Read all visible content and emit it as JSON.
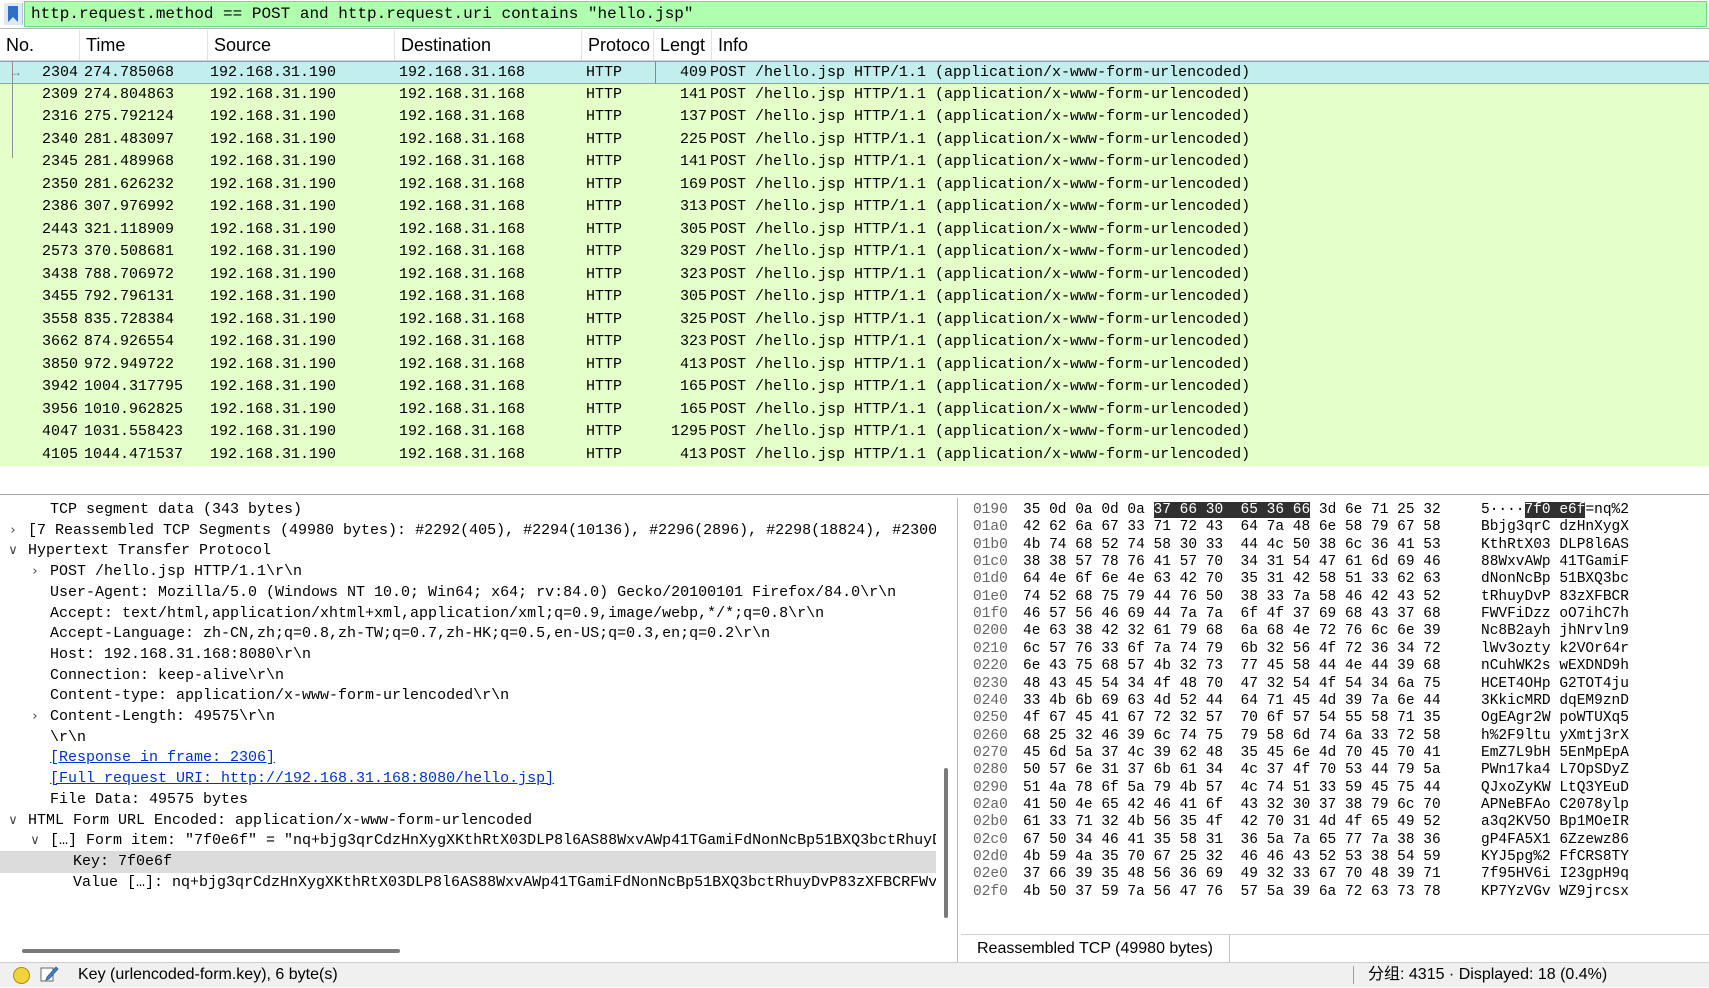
{
  "filter": {
    "text": "http.request.method == POST and http.request.uri contains \"hello.jsp\""
  },
  "columns": [
    "No.",
    "Time",
    "Source",
    "Destination",
    "Protoco",
    "Lengt",
    "Info"
  ],
  "packets": [
    {
      "no": "2304",
      "time": "274.785068",
      "src": "192.168.31.190",
      "dst": "192.168.31.168",
      "proto": "HTTP",
      "len": "409",
      "info": "POST /hello.jsp HTTP/1.1  (application/x-www-form-urlencoded)",
      "selected": true
    },
    {
      "no": "2309",
      "time": "274.804863",
      "src": "192.168.31.190",
      "dst": "192.168.31.168",
      "proto": "HTTP",
      "len": "141",
      "info": "POST /hello.jsp HTTP/1.1  (application/x-www-form-urlencoded)"
    },
    {
      "no": "2316",
      "time": "275.792124",
      "src": "192.168.31.190",
      "dst": "192.168.31.168",
      "proto": "HTTP",
      "len": "137",
      "info": "POST /hello.jsp HTTP/1.1  (application/x-www-form-urlencoded)"
    },
    {
      "no": "2340",
      "time": "281.483097",
      "src": "192.168.31.190",
      "dst": "192.168.31.168",
      "proto": "HTTP",
      "len": "225",
      "info": "POST /hello.jsp HTTP/1.1  (application/x-www-form-urlencoded)"
    },
    {
      "no": "2345",
      "time": "281.489968",
      "src": "192.168.31.190",
      "dst": "192.168.31.168",
      "proto": "HTTP",
      "len": "141",
      "info": "POST /hello.jsp HTTP/1.1  (application/x-www-form-urlencoded)"
    },
    {
      "no": "2350",
      "time": "281.626232",
      "src": "192.168.31.190",
      "dst": "192.168.31.168",
      "proto": "HTTP",
      "len": "169",
      "info": "POST /hello.jsp HTTP/1.1  (application/x-www-form-urlencoded)"
    },
    {
      "no": "2386",
      "time": "307.976992",
      "src": "192.168.31.190",
      "dst": "192.168.31.168",
      "proto": "HTTP",
      "len": "313",
      "info": "POST /hello.jsp HTTP/1.1  (application/x-www-form-urlencoded)"
    },
    {
      "no": "2443",
      "time": "321.118909",
      "src": "192.168.31.190",
      "dst": "192.168.31.168",
      "proto": "HTTP",
      "len": "305",
      "info": "POST /hello.jsp HTTP/1.1  (application/x-www-form-urlencoded)"
    },
    {
      "no": "2573",
      "time": "370.508681",
      "src": "192.168.31.190",
      "dst": "192.168.31.168",
      "proto": "HTTP",
      "len": "329",
      "info": "POST /hello.jsp HTTP/1.1  (application/x-www-form-urlencoded)"
    },
    {
      "no": "3438",
      "time": "788.706972",
      "src": "192.168.31.190",
      "dst": "192.168.31.168",
      "proto": "HTTP",
      "len": "323",
      "info": "POST /hello.jsp HTTP/1.1  (application/x-www-form-urlencoded)"
    },
    {
      "no": "3455",
      "time": "792.796131",
      "src": "192.168.31.190",
      "dst": "192.168.31.168",
      "proto": "HTTP",
      "len": "305",
      "info": "POST /hello.jsp HTTP/1.1  (application/x-www-form-urlencoded)"
    },
    {
      "no": "3558",
      "time": "835.728384",
      "src": "192.168.31.190",
      "dst": "192.168.31.168",
      "proto": "HTTP",
      "len": "325",
      "info": "POST /hello.jsp HTTP/1.1  (application/x-www-form-urlencoded)"
    },
    {
      "no": "3662",
      "time": "874.926554",
      "src": "192.168.31.190",
      "dst": "192.168.31.168",
      "proto": "HTTP",
      "len": "323",
      "info": "POST /hello.jsp HTTP/1.1  (application/x-www-form-urlencoded)"
    },
    {
      "no": "3850",
      "time": "972.949722",
      "src": "192.168.31.190",
      "dst": "192.168.31.168",
      "proto": "HTTP",
      "len": "413",
      "info": "POST /hello.jsp HTTP/1.1  (application/x-www-form-urlencoded)"
    },
    {
      "no": "3942",
      "time": "1004.317795",
      "src": "192.168.31.190",
      "dst": "192.168.31.168",
      "proto": "HTTP",
      "len": "165",
      "info": "POST /hello.jsp HTTP/1.1  (application/x-www-form-urlencoded)"
    },
    {
      "no": "3956",
      "time": "1010.962825",
      "src": "192.168.31.190",
      "dst": "192.168.31.168",
      "proto": "HTTP",
      "len": "165",
      "info": "POST /hello.jsp HTTP/1.1  (application/x-www-form-urlencoded)"
    },
    {
      "no": "4047",
      "time": "1031.558423",
      "src": "192.168.31.190",
      "dst": "192.168.31.168",
      "proto": "HTTP",
      "len": "1295",
      "info": "POST /hello.jsp HTTP/1.1  (application/x-www-form-urlencoded)"
    },
    {
      "no": "4105",
      "time": "1044.471537",
      "src": "192.168.31.190",
      "dst": "192.168.31.168",
      "proto": "HTTP",
      "len": "413",
      "info": "POST /hello.jsp HTTP/1.1  (application/x-www-form-urlencoded)"
    }
  ],
  "details": [
    {
      "text": "TCP segment data (343 bytes)",
      "indent": 2,
      "arrow": ""
    },
    {
      "text": "[7 Reassembled TCP Segments (49980 bytes): #2292(405), #2294(10136), #2296(2896), #2298(18824), #2300",
      "indent": 1,
      "arrow": "collapsed"
    },
    {
      "text": "Hypertext Transfer Protocol",
      "indent": 1,
      "arrow": "expanded"
    },
    {
      "text": "POST /hello.jsp HTTP/1.1\\r\\n",
      "indent": 2,
      "arrow": "collapsed"
    },
    {
      "text": "User-Agent: Mozilla/5.0 (Windows NT 10.0; Win64; x64; rv:84.0) Gecko/20100101 Firefox/84.0\\r\\n",
      "indent": 2,
      "arrow": ""
    },
    {
      "text": "Accept: text/html,application/xhtml+xml,application/xml;q=0.9,image/webp,*/*;q=0.8\\r\\n",
      "indent": 2,
      "arrow": ""
    },
    {
      "text": "Accept-Language: zh-CN,zh;q=0.8,zh-TW;q=0.7,zh-HK;q=0.5,en-US;q=0.3,en;q=0.2\\r\\n",
      "indent": 2,
      "arrow": ""
    },
    {
      "text": "Host: 192.168.31.168:8080\\r\\n",
      "indent": 2,
      "arrow": ""
    },
    {
      "text": "Connection: keep-alive\\r\\n",
      "indent": 2,
      "arrow": ""
    },
    {
      "text": "Content-type: application/x-www-form-urlencoded\\r\\n",
      "indent": 2,
      "arrow": ""
    },
    {
      "text": "Content-Length: 49575\\r\\n",
      "indent": 2,
      "arrow": "collapsed"
    },
    {
      "text": "\\r\\n",
      "indent": 2,
      "arrow": ""
    },
    {
      "text": "[Response in frame: 2306]",
      "indent": 2,
      "arrow": "",
      "link": true
    },
    {
      "text": "[Full request URI: http://192.168.31.168:8080/hello.jsp]",
      "indent": 2,
      "arrow": "",
      "link": true
    },
    {
      "text": "File Data: 49575 bytes",
      "indent": 2,
      "arrow": ""
    },
    {
      "text": "HTML Form URL Encoded: application/x-www-form-urlencoded",
      "indent": 1,
      "arrow": "expanded"
    },
    {
      "text": "[…] Form item: \"7f0e6f\" = \"nq+bjg3qrCdzHnXygXKthRtX03DLP8l6AS88WxvAWp41TGamiFdNonNcBp51BXQ3bctRhuyD",
      "indent": 2,
      "arrow": "expanded"
    },
    {
      "text": "Key: 7f0e6f",
      "indent": 3,
      "arrow": "",
      "selected": true
    },
    {
      "text": "Value […]: nq+bjg3qrCdzHnXygXKthRtX03DLP8l6AS88WxvAWp41TGamiFdNonNcBp51BXQ3bctRhuyDvP83zXFBCRFWv",
      "indent": 3,
      "arrow": ""
    }
  ],
  "bytes": [
    {
      "offset": "0190",
      "hex": [
        "35 0d 0a 0d 0a ",
        "37 66 30  65 36 66",
        " 3d 6e 71 25 32"
      ],
      "ascii": [
        "5····",
        "7f0 e6f",
        "=nq%2"
      ]
    },
    {
      "offset": "01a0",
      "hex": [
        "42 62 6a 67 33 71 72 43  64 7a 48 6e 58 79 67 58"
      ],
      "ascii": [
        "Bbjg3qrC dzHnXygX"
      ]
    },
    {
      "offset": "01b0",
      "hex": [
        "4b 74 68 52 74 58 30 33  44 4c 50 38 6c 36 41 53"
      ],
      "ascii": [
        "KthRtX03 DLP8l6AS"
      ]
    },
    {
      "offset": "01c0",
      "hex": [
        "38 38 57 78 76 41 57 70  34 31 54 47 61 6d 69 46"
      ],
      "ascii": [
        "88WxvAWp 41TGamiF"
      ]
    },
    {
      "offset": "01d0",
      "hex": [
        "64 4e 6f 6e 4e 63 42 70  35 31 42 58 51 33 62 63"
      ],
      "ascii": [
        "dNonNcBp 51BXQ3bc"
      ]
    },
    {
      "offset": "01e0",
      "hex": [
        "74 52 68 75 79 44 76 50  38 33 7a 58 46 42 43 52"
      ],
      "ascii": [
        "tRhuyDvP 83zXFBCR"
      ]
    },
    {
      "offset": "01f0",
      "hex": [
        "46 57 56 46 69 44 7a 7a  6f 4f 37 69 68 43 37 68"
      ],
      "ascii": [
        "FWVFiDzz oO7ihC7h"
      ]
    },
    {
      "offset": "0200",
      "hex": [
        "4e 63 38 42 32 61 79 68  6a 68 4e 72 76 6c 6e 39"
      ],
      "ascii": [
        "Nc8B2ayh jhNrvln9"
      ]
    },
    {
      "offset": "0210",
      "hex": [
        "6c 57 76 33 6f 7a 74 79  6b 32 56 4f 72 36 34 72"
      ],
      "ascii": [
        "lWv3ozty k2VOr64r"
      ]
    },
    {
      "offset": "0220",
      "hex": [
        "6e 43 75 68 57 4b 32 73  77 45 58 44 4e 44 39 68"
      ],
      "ascii": [
        "nCuhWK2s wEXDND9h"
      ]
    },
    {
      "offset": "0230",
      "hex": [
        "48 43 45 54 34 4f 48 70  47 32 54 4f 54 34 6a 75"
      ],
      "ascii": [
        "HCET4OHp G2TOT4ju"
      ]
    },
    {
      "offset": "0240",
      "hex": [
        "33 4b 6b 69 63 4d 52 44  64 71 45 4d 39 7a 6e 44"
      ],
      "ascii": [
        "3KkicMRD dqEM9znD"
      ]
    },
    {
      "offset": "0250",
      "hex": [
        "4f 67 45 41 67 72 32 57  70 6f 57 54 55 58 71 35"
      ],
      "ascii": [
        "OgEAgr2W poWTUXq5"
      ]
    },
    {
      "offset": "0260",
      "hex": [
        "68 25 32 46 39 6c 74 75  79 58 6d 74 6a 33 72 58"
      ],
      "ascii": [
        "h%2F9ltu yXmtj3rX"
      ]
    },
    {
      "offset": "0270",
      "hex": [
        "45 6d 5a 37 4c 39 62 48  35 45 6e 4d 70 45 70 41"
      ],
      "ascii": [
        "EmZ7L9bH 5EnMpEpA"
      ]
    },
    {
      "offset": "0280",
      "hex": [
        "50 57 6e 31 37 6b 61 34  4c 37 4f 70 53 44 79 5a"
      ],
      "ascii": [
        "PWn17ka4 L7OpSDyZ"
      ]
    },
    {
      "offset": "0290",
      "hex": [
        "51 4a 78 6f 5a 79 4b 57  4c 74 51 33 59 45 75 44"
      ],
      "ascii": [
        "QJxoZyKW LtQ3YEuD"
      ]
    },
    {
      "offset": "02a0",
      "hex": [
        "41 50 4e 65 42 46 41 6f  43 32 30 37 38 79 6c 70"
      ],
      "ascii": [
        "APNeBFAo C2078ylp"
      ]
    },
    {
      "offset": "02b0",
      "hex": [
        "61 33 71 32 4b 56 35 4f  42 70 31 4d 4f 65 49 52"
      ],
      "ascii": [
        "a3q2KV5O Bp1MOeIR"
      ]
    },
    {
      "offset": "02c0",
      "hex": [
        "67 50 34 46 41 35 58 31  36 5a 7a 65 77 7a 38 36"
      ],
      "ascii": [
        "gP4FA5X1 6Zzewz86"
      ]
    },
    {
      "offset": "02d0",
      "hex": [
        "4b 59 4a 35 70 67 25 32  46 46 43 52 53 38 54 59"
      ],
      "ascii": [
        "KYJ5pg%2 FfCRS8TY"
      ]
    },
    {
      "offset": "02e0",
      "hex": [
        "37 66 39 35 48 56 36 69  49 32 33 67 70 48 39 71"
      ],
      "ascii": [
        "7f95HV6i I23gpH9q"
      ]
    },
    {
      "offset": "02f0",
      "hex": [
        "4b 50 37 59 7a 56 47 76  57 5a 39 6a 72 63 73 78"
      ],
      "ascii": [
        "KP7YzVGv WZ9jrcsx"
      ]
    }
  ],
  "bytes_tab": "Reassembled TCP (49980 bytes)",
  "status": {
    "left": "Key (urlencoded-form.key), 6 byte(s)",
    "right": "分组: 4315 · Displayed: 18 (0.4%)"
  },
  "colors": {
    "row_bg": "#e4ffc7",
    "selected_row_bg": "#c3eeee",
    "filter_bg": "#afffaf",
    "byte_highlight": "#303030"
  }
}
